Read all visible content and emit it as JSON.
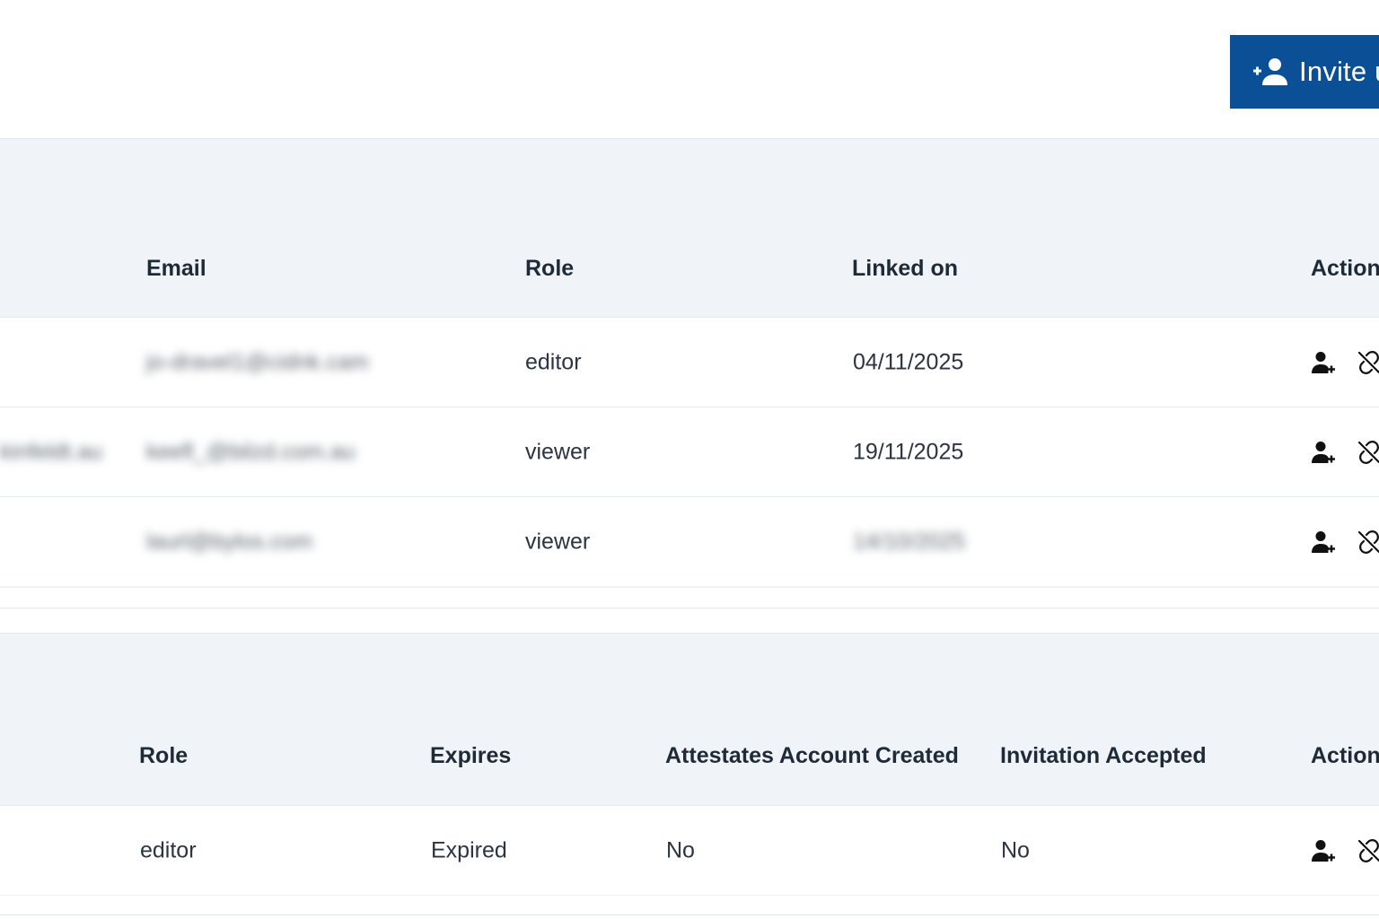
{
  "header": {
    "invite_label": "Invite u"
  },
  "linked_table": {
    "headers": {
      "email": "Email",
      "role": "Role",
      "linked_on": "Linked on",
      "actions": "Actions"
    },
    "rows": [
      {
        "partial_left": "",
        "email": "jo-dravel1@cidnk.cam",
        "role": "editor",
        "linked_on": "04/11/2025"
      },
      {
        "partial_left": "kinfeldt.au",
        "email": "keefl_@bilzd.com.au",
        "role": "viewer",
        "linked_on": "19/11/2025"
      },
      {
        "partial_left": "",
        "email": "laurl@bylos.com",
        "role": "viewer",
        "linked_on": "14/10/2025"
      }
    ]
  },
  "invitations_table": {
    "headers": {
      "role": "Role",
      "expires": "Expires",
      "account_created": "Attestates Account Created",
      "accepted": "Invitation Accepted",
      "actions": "Actions"
    },
    "rows": [
      {
        "role": "editor",
        "expires": "Expired",
        "account_created": "No",
        "accepted": "No"
      }
    ]
  },
  "icons": {
    "invite": "person-add-icon",
    "row_add": "person-add-icon",
    "row_unlink": "unlink-icon"
  },
  "colors": {
    "primary": "#0b4f96",
    "panel_bg": "#f0f4f9"
  }
}
